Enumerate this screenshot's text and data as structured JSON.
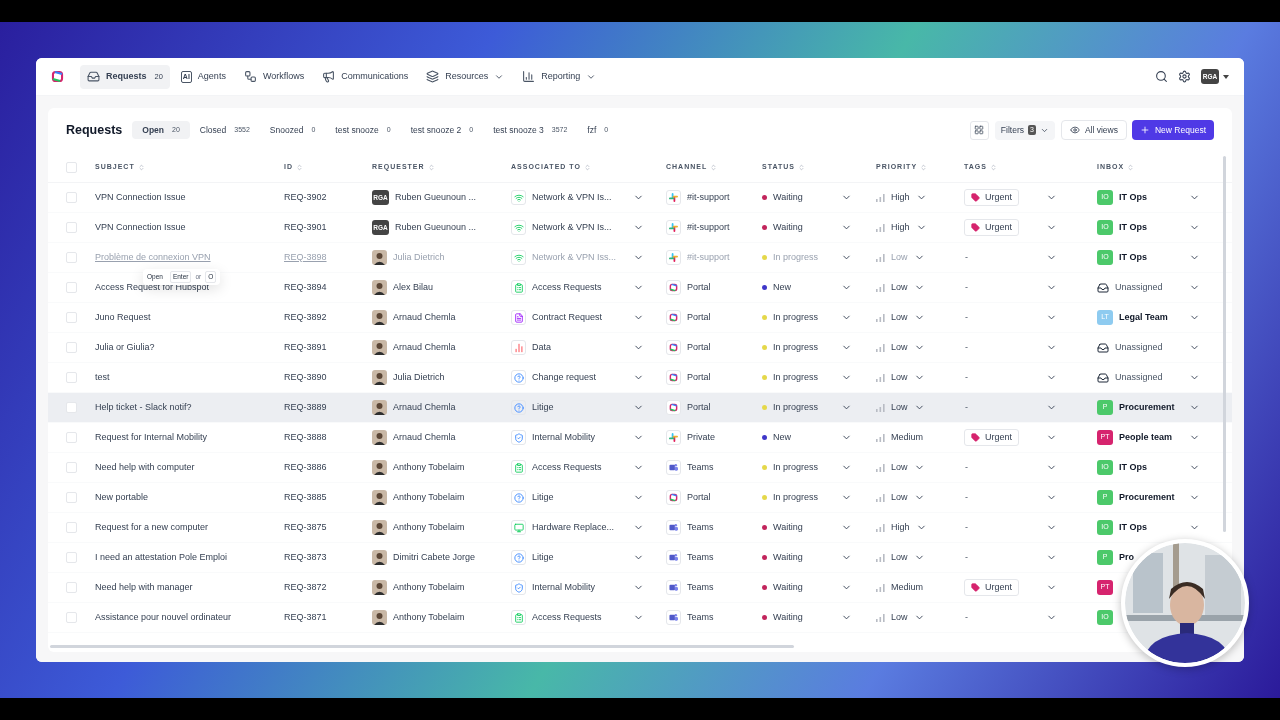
{
  "nav": {
    "items": [
      {
        "label": "Requests",
        "count": "20",
        "selected": true,
        "dropdown": false
      },
      {
        "label": "Agents",
        "selected": false,
        "dropdown": false,
        "icon_text": "AI"
      },
      {
        "label": "Workflows",
        "selected": false,
        "dropdown": false
      },
      {
        "label": "Communications",
        "selected": false,
        "dropdown": false
      },
      {
        "label": "Resources",
        "selected": false,
        "dropdown": true
      },
      {
        "label": "Reporting",
        "selected": false,
        "dropdown": true
      }
    ],
    "user": "RGA"
  },
  "title": "Requests",
  "views": [
    {
      "label": "Open",
      "count": "20",
      "selected": true
    },
    {
      "label": "Closed",
      "count": "3552",
      "selected": false
    },
    {
      "label": "Snoozed",
      "count": "0",
      "selected": false
    },
    {
      "label": "test snooze",
      "count": "0",
      "selected": false
    },
    {
      "label": "test snooze 2",
      "count": "0",
      "selected": false
    },
    {
      "label": "test snooze 3",
      "count": "3572",
      "selected": false
    },
    {
      "label": "fzf",
      "count": "0",
      "selected": false
    }
  ],
  "filters": {
    "label": "Filters",
    "count": "3"
  },
  "all_views": "All views",
  "new_request": "New Request",
  "select_all": {
    "checked": false
  },
  "columns": [
    "SUBJECT",
    "ID",
    "REQUESTER",
    "ASSOCIATED TO",
    "CHANNEL",
    "STATUS",
    "PRIORITY",
    "TAGS",
    "INBOX"
  ],
  "rows": [
    {
      "subject": "VPN Connection Issue",
      "id": "REQ-3902",
      "requester": {
        "name": "Ruben Gueunoun ...",
        "initials": "RGA",
        "kind": "initials"
      },
      "associated": {
        "label": "Network & VPN Is...",
        "kind": "wifi"
      },
      "channel": {
        "label": "#it-support",
        "kind": "slack"
      },
      "status": {
        "label": "Waiting",
        "color": "#c2255c"
      },
      "priority": "High",
      "tag": "Urgent",
      "inbox": {
        "kind": "team",
        "badge": "IO",
        "label": "IT Ops",
        "color": "#4cc96a"
      },
      "muted": false,
      "highlighted": false
    },
    {
      "subject": "VPN Connection Issue",
      "id": "REQ-3901",
      "requester": {
        "name": "Ruben Gueunoun ...",
        "initials": "RGA",
        "kind": "initials"
      },
      "associated": {
        "label": "Network & VPN Is...",
        "kind": "wifi"
      },
      "channel": {
        "label": "#it-support",
        "kind": "slack"
      },
      "status": {
        "label": "Waiting",
        "color": "#c2255c"
      },
      "priority": "High",
      "tag": "Urgent",
      "inbox": {
        "kind": "team",
        "badge": "IO",
        "label": "IT Ops",
        "color": "#4cc96a"
      },
      "muted": false,
      "highlighted": false
    },
    {
      "subject": "Problème de connexion VPN",
      "id": "REQ-3898",
      "requester": {
        "name": "Julia Dietrich"
      },
      "associated": {
        "label": "Network & VPN Iss...",
        "kind": "wifi"
      },
      "channel": {
        "label": "#it-support",
        "kind": "slack"
      },
      "status": {
        "label": "In progress",
        "color": "#e5d84a"
      },
      "priority": "Low",
      "tag": "-",
      "inbox": {
        "kind": "team",
        "badge": "IO",
        "label": "IT Ops",
        "color": "#4cc96a"
      },
      "muted": true,
      "highlighted": false
    },
    {
      "subject": "Access Request for Hubspot",
      "id": "REQ-3894",
      "requester": {
        "name": "Alex Bilau"
      },
      "associated": {
        "label": "Access Requests",
        "kind": "list"
      },
      "channel": {
        "label": "Portal",
        "kind": "portal"
      },
      "status": {
        "label": "New",
        "color": "#3f37c9"
      },
      "priority": "Low",
      "tag": "-",
      "inbox": {
        "kind": "unassigned",
        "label": "Unassigned"
      },
      "muted": false,
      "highlighted": false
    },
    {
      "subject": "Juno Request",
      "id": "REQ-3892",
      "requester": {
        "name": "Arnaud Chemla"
      },
      "associated": {
        "label": "Contract Request",
        "kind": "contract"
      },
      "channel": {
        "label": "Portal",
        "kind": "portal"
      },
      "status": {
        "label": "In progress",
        "color": "#e5d84a"
      },
      "priority": "Low",
      "tag": "-",
      "inbox": {
        "kind": "team",
        "badge": "LT",
        "label": "Legal Team",
        "color": "#8ecbf0"
      },
      "muted": false,
      "highlighted": false
    },
    {
      "subject": "Julia or Giulia?",
      "id": "REQ-3891",
      "requester": {
        "name": "Arnaud Chemla"
      },
      "associated": {
        "label": "Data",
        "kind": "data"
      },
      "channel": {
        "label": "Portal",
        "kind": "portal"
      },
      "status": {
        "label": "In progress",
        "color": "#e5d84a"
      },
      "priority": "Low",
      "tag": "-",
      "inbox": {
        "kind": "unassigned",
        "label": "Unassigned"
      },
      "muted": false,
      "highlighted": false
    },
    {
      "subject": "test",
      "id": "REQ-3890",
      "requester": {
        "name": "Julia Dietrich"
      },
      "associated": {
        "label": "Change request",
        "kind": "question"
      },
      "channel": {
        "label": "Portal",
        "kind": "portal"
      },
      "status": {
        "label": "In progress",
        "color": "#e5d84a"
      },
      "priority": "Low",
      "tag": "-",
      "inbox": {
        "kind": "unassigned",
        "label": "Unassigned"
      },
      "muted": false,
      "highlighted": false
    },
    {
      "subject": "Help ticket - Slack notif?",
      "id": "REQ-3889",
      "requester": {
        "name": "Arnaud Chemla"
      },
      "associated": {
        "label": "Litige",
        "kind": "question"
      },
      "channel": {
        "label": "Portal",
        "kind": "portal"
      },
      "status": {
        "label": "In progress",
        "color": "#e5d84a"
      },
      "priority": "Low",
      "tag": "-",
      "inbox": {
        "kind": "team",
        "badge": "P",
        "label": "Procurement",
        "color": "#4cc96a"
      },
      "muted": false,
      "highlighted": true
    },
    {
      "subject": "Request for Internal Mobility",
      "id": "REQ-3888",
      "requester": {
        "name": "Arnaud Chemla"
      },
      "associated": {
        "label": "Internal Mobility",
        "kind": "shield"
      },
      "channel": {
        "label": "Private",
        "kind": "slack"
      },
      "status": {
        "label": "New",
        "color": "#3f37c9"
      },
      "priority": "Medium",
      "tag": "Urgent",
      "inbox": {
        "kind": "team",
        "badge": "PT",
        "label": "People team",
        "color": "#d6246e"
      },
      "muted": false,
      "highlighted": false
    },
    {
      "subject": "Need help with computer",
      "id": "REQ-3886",
      "requester": {
        "name": "Anthony Tobelaim"
      },
      "associated": {
        "label": "Access Requests",
        "kind": "list"
      },
      "channel": {
        "label": "Teams",
        "kind": "teams"
      },
      "status": {
        "label": "In progress",
        "color": "#e5d84a"
      },
      "priority": "Low",
      "tag": "-",
      "inbox": {
        "kind": "team",
        "badge": "IO",
        "label": "IT Ops",
        "color": "#4cc96a"
      },
      "muted": false,
      "highlighted": false
    },
    {
      "subject": "New portable",
      "id": "REQ-3885",
      "requester": {
        "name": "Anthony Tobelaim"
      },
      "associated": {
        "label": "Litige",
        "kind": "question"
      },
      "channel": {
        "label": "Portal",
        "kind": "portal"
      },
      "status": {
        "label": "In progress",
        "color": "#e5d84a"
      },
      "priority": "Low",
      "tag": "-",
      "inbox": {
        "kind": "team",
        "badge": "P",
        "label": "Procurement",
        "color": "#4cc96a"
      },
      "muted": false,
      "highlighted": false
    },
    {
      "subject": "Request for a new computer",
      "id": "REQ-3875",
      "requester": {
        "name": "Anthony Tobelaim"
      },
      "associated": {
        "label": "Hardware Replace...",
        "kind": "monitor"
      },
      "channel": {
        "label": "Teams",
        "kind": "teams"
      },
      "status": {
        "label": "Waiting",
        "color": "#c2255c"
      },
      "priority": "High",
      "tag": "-",
      "inbox": {
        "kind": "team",
        "badge": "IO",
        "label": "IT Ops",
        "color": "#4cc96a"
      },
      "muted": false,
      "highlighted": false
    },
    {
      "subject": "I need an attestation Pole Emploi",
      "id": "REQ-3873",
      "requester": {
        "name": "Dimitri Cabete Jorge"
      },
      "associated": {
        "label": "Litige",
        "kind": "question"
      },
      "channel": {
        "label": "Teams",
        "kind": "teams"
      },
      "status": {
        "label": "Waiting",
        "color": "#c2255c"
      },
      "priority": "Low",
      "tag": "-",
      "inbox": {
        "kind": "team",
        "badge": "P",
        "label": "Pro",
        "color": "#4cc96a"
      },
      "muted": false,
      "highlighted": false
    },
    {
      "subject": "Need help with manager",
      "id": "REQ-3872",
      "requester": {
        "name": "Anthony Tobelaim"
      },
      "associated": {
        "label": "Internal Mobility",
        "kind": "shield"
      },
      "channel": {
        "label": "Teams",
        "kind": "teams"
      },
      "status": {
        "label": "Waiting",
        "color": "#c2255c"
      },
      "priority": "Medium",
      "tag": "Urgent",
      "inbox": {
        "kind": "team",
        "badge": "PT",
        "color": "#d6246e"
      },
      "muted": false,
      "highlighted": false
    },
    {
      "subject": "Assistance pour nouvel ordinateur",
      "id": "REQ-3871",
      "requester": {
        "name": "Anthony Tobelaim"
      },
      "associated": {
        "label": "Access Requests",
        "kind": "list"
      },
      "channel": {
        "label": "Teams",
        "kind": "teams"
      },
      "status": {
        "label": "Waiting",
        "color": "#c2255c"
      },
      "priority": "Low",
      "tag": "-",
      "inbox": {
        "kind": "team",
        "badge": "IO",
        "color": "#4cc96a"
      },
      "muted": false,
      "highlighted": false
    }
  ],
  "tooltip": {
    "label": "Open",
    "keys": [
      "Enter",
      "O"
    ],
    "separator": "or"
  }
}
